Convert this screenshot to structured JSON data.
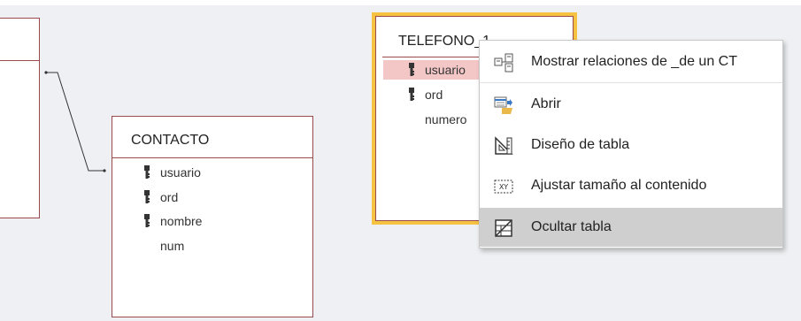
{
  "tables": {
    "contacto": {
      "title": "CONTACTO",
      "fields": [
        {
          "name": "usuario",
          "key": true
        },
        {
          "name": "ord",
          "key": true
        },
        {
          "name": "nombre",
          "key": true
        },
        {
          "name": "num",
          "key": false
        }
      ]
    },
    "telefono": {
      "title": "TELEFONO_1",
      "fields": [
        {
          "name": "usuario",
          "key": true,
          "selected": true
        },
        {
          "name": "ord",
          "key": true
        },
        {
          "name": "numero",
          "key": false
        }
      ]
    }
  },
  "context_menu": {
    "items": [
      {
        "label": "Mostrar relaciones de _de un CT",
        "icon": "relationships-icon"
      },
      {
        "label": "Abrir",
        "icon": "open-table-icon"
      },
      {
        "label": "Diseño de tabla",
        "icon": "design-view-icon"
      },
      {
        "label": "Ajustar tamaño al contenido",
        "icon": "size-to-fit-icon"
      },
      {
        "label": "Ocultar tabla",
        "icon": "hide-table-icon",
        "highlighted": true
      }
    ]
  },
  "colors": {
    "canvas": "#eef0f3",
    "table_border": "#9a4a4a",
    "selected_table_border": "#f5c242",
    "selected_row": "#f4c7c7",
    "menu_hover": "#cfcfcf"
  }
}
